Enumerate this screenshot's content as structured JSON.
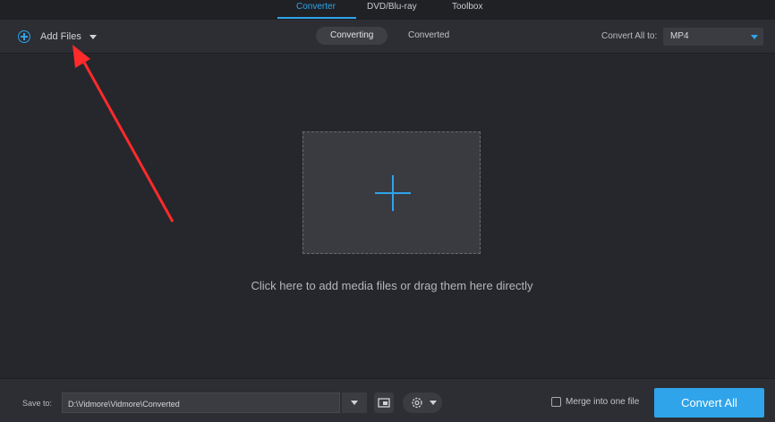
{
  "nav": {
    "tabs": [
      {
        "label": "Converter",
        "active": true
      },
      {
        "label": "DVD/Blu-ray",
        "active": false
      },
      {
        "label": "Toolbox",
        "active": false
      }
    ]
  },
  "toolbar": {
    "add_files_label": "Add Files",
    "segments": [
      {
        "label": "Converting",
        "active": true
      },
      {
        "label": "Converted",
        "active": false
      }
    ],
    "convert_all_label": "Convert All to:",
    "format_value": "MP4"
  },
  "main": {
    "hint": "Click here to add media files or drag them here directly"
  },
  "bottom": {
    "save_label": "Save to:",
    "save_path": "D:\\Vidmore\\Vidmore\\Converted",
    "merge_label": "Merge into one file",
    "merge_checked": false,
    "convert_button": "Convert All"
  },
  "colors": {
    "accent": "#2fa4ea",
    "annotation_arrow": "#ff2a2a"
  }
}
